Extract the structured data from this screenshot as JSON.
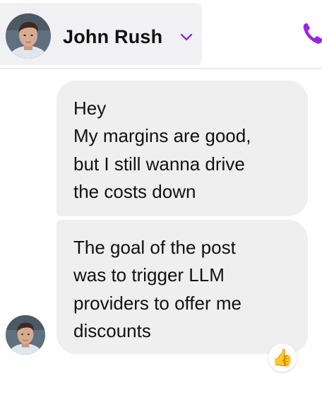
{
  "header": {
    "contact_name": "John Rush",
    "avatar_icon": "contact-avatar",
    "dropdown_icon": "chevron-down-icon",
    "call_icon": "phone-icon",
    "accent_color": "#9b22e6"
  },
  "messages": [
    {
      "lines": [
        "Hey",
        "My margins are good,",
        "but I still wanna drive",
        "the costs down"
      ]
    },
    {
      "lines": [
        "The goal of the post",
        "was to trigger LLM",
        "providers to offer me",
        "discounts"
      ],
      "reaction": "👍"
    }
  ]
}
